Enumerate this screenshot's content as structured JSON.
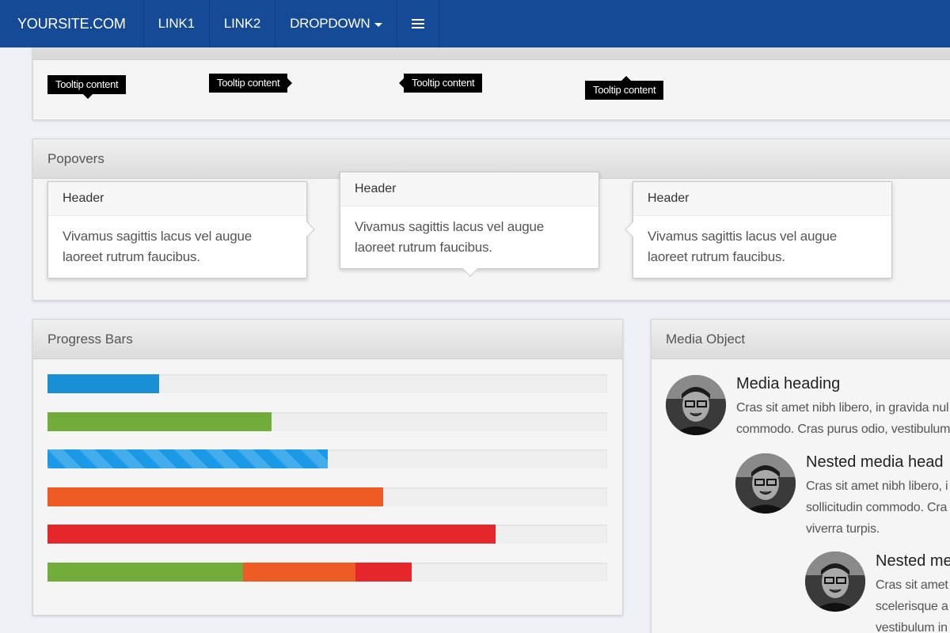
{
  "navbar": {
    "brand": "YOURSITE.COM",
    "links": [
      "LINK1",
      "LINK2"
    ],
    "dropdown": "DROPDOWN"
  },
  "tooltips": {
    "items": [
      "Tooltip content",
      "Tooltip content",
      "Tooltip content",
      "Tooltip content"
    ]
  },
  "popovers": {
    "title": "Popovers",
    "items": [
      {
        "header": "Header",
        "content": "Vivamus sagittis lacus vel augue laoreet rutrum faucibus."
      },
      {
        "header": "Header",
        "content": "Vivamus sagittis lacus vel augue laoreet rutrum faucibus."
      },
      {
        "header": "Header",
        "content": "Vivamus sagittis lacus vel augue laoreet rutrum faucibus."
      }
    ]
  },
  "progress": {
    "title": "Progress Bars",
    "bars": [
      {
        "percent": 20,
        "color": "#1a8fd6",
        "style": "blue"
      },
      {
        "percent": 40,
        "color": "#72ad3b",
        "style": "green"
      },
      {
        "percent": 50,
        "color": "#1a9ae6",
        "style": "striped"
      },
      {
        "percent": 60,
        "color": "#ef5b25",
        "style": "orange"
      },
      {
        "percent": 80,
        "color": "#e5262a",
        "style": "red"
      }
    ],
    "stacked": [
      {
        "percent": 35,
        "color": "#72ad3b"
      },
      {
        "percent": 20,
        "color": "#ef5b25"
      },
      {
        "percent": 10,
        "color": "#e5262a"
      }
    ]
  },
  "media": {
    "title": "Media Object",
    "items": [
      {
        "heading": "Media heading",
        "lines": [
          "Cras sit amet nibh libero, in gravida nul",
          "commodo. Cras purus odio, vestibulum"
        ]
      },
      {
        "heading": "Nested media head",
        "lines": [
          "Cras sit amet nibh libero, i",
          "sollicitudin commodo. Cra",
          "viverra turpis."
        ]
      },
      {
        "heading": "Nested me",
        "lines": [
          "Cras sit amet",
          "scelerisque a",
          "vestibulum in"
        ]
      }
    ]
  },
  "colors": {
    "navbar": "#154a96",
    "progress_blue": "#1a8fd6",
    "progress_green": "#72ad3b",
    "progress_orange": "#ef5b25",
    "progress_red": "#e5262a"
  }
}
